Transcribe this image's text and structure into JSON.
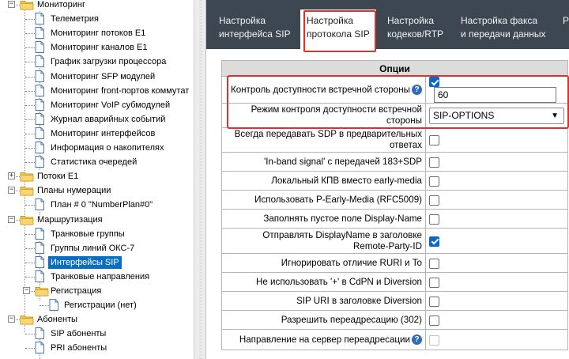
{
  "tree": {
    "items": [
      {
        "label": "Мониторинг",
        "type": "folder"
      },
      {
        "label": "Телеметрия",
        "type": "page"
      },
      {
        "label": "Мониторинг потоков E1",
        "type": "page"
      },
      {
        "label": "Мониторинг каналов E1",
        "type": "page"
      },
      {
        "label": "График загрузки процессора",
        "type": "page"
      },
      {
        "label": "Мониторинг SFP модулей",
        "type": "page"
      },
      {
        "label": "Мониторинг front-портов коммутат",
        "type": "page"
      },
      {
        "label": "Мониторинг VoIP субмодулей",
        "type": "page"
      },
      {
        "label": "Журнал аварийных событий",
        "type": "page"
      },
      {
        "label": "Мониторинг интерфейсов",
        "type": "page"
      },
      {
        "label": "Информация о накопителях",
        "type": "page"
      },
      {
        "label": "Статистика очередей",
        "type": "page"
      },
      {
        "label": "Потоки E1",
        "type": "folder",
        "expander": "+"
      },
      {
        "label": "Планы нумерации",
        "type": "folder",
        "expander": "−"
      },
      {
        "label": "План # 0 \"NumberPlan#0\"",
        "type": "page"
      },
      {
        "label": "Маршрутизация",
        "type": "folder",
        "expander": "−"
      },
      {
        "label": "Транковые группы",
        "type": "page"
      },
      {
        "label": "Группы линий ОКС-7",
        "type": "page"
      },
      {
        "label": "Интерфейсы SIP",
        "type": "page",
        "selected": true
      },
      {
        "label": "Транковые направления",
        "type": "page"
      },
      {
        "label": "Регистрация",
        "type": "folder",
        "expander": "−"
      },
      {
        "label": "Регистрации (нет)",
        "type": "page"
      },
      {
        "label": "Абоненты",
        "type": "folder",
        "expander": "−"
      },
      {
        "label": "SIP абоненты",
        "type": "page"
      },
      {
        "label": "PRI абоненты",
        "type": "page"
      }
    ]
  },
  "tabs": [
    {
      "line1": "Настройка",
      "line2": "интерфейса SIP",
      "active": false
    },
    {
      "line1": "Настройка",
      "line2": "протокола SIP",
      "active": true
    },
    {
      "line1": "Настройка",
      "line2": "кодеков/RTP",
      "active": false
    },
    {
      "line1": "Настройка факса",
      "line2": "и передачи данных",
      "active": false
    },
    {
      "line1": "Р",
      "line2": "",
      "active": false
    }
  ],
  "options": {
    "header": "Опции",
    "rows": [
      {
        "label": "Контроль доступности встречной стороны",
        "help": true,
        "control": "checkbox+number",
        "checked": true,
        "value": "60"
      },
      {
        "label": "Режим контроля доступности встречной стороны",
        "control": "select",
        "value": "SIP-OPTIONS"
      },
      {
        "label": "Всегда передавать SDP в предварительных ответах",
        "control": "checkbox",
        "checked": false
      },
      {
        "label": "'In-band signal' с передачей 183+SDP",
        "control": "checkbox",
        "checked": false
      },
      {
        "label": "Локальный КПВ вместо early-media",
        "control": "checkbox",
        "checked": false
      },
      {
        "label": "Использовать P-Early-Media (RFC5009)",
        "control": "checkbox",
        "checked": false
      },
      {
        "label": "Заполнять пустое поле Display-Name",
        "control": "checkbox",
        "checked": false
      },
      {
        "label": "Отправлять DisplayName в заголовке Remote-Party-ID",
        "control": "checkbox",
        "checked": true
      },
      {
        "label": "Игнорировать отличие RURI и To",
        "control": "checkbox",
        "checked": false
      },
      {
        "label": "Не использовать '+' в CdPN и Diversion",
        "control": "checkbox",
        "checked": false
      },
      {
        "label": "SIP URI в заголовке Diversion",
        "control": "checkbox",
        "checked": false
      },
      {
        "label": "Разрешить переадресацию (302)",
        "control": "checkbox",
        "checked": false
      },
      {
        "label": "Направление на сервер переадресации",
        "help": true,
        "control": "checkbox",
        "checked": false,
        "disabled": true
      }
    ]
  },
  "colors": {
    "tabbar_bg": "#3d4752",
    "selected_bg": "#0a6fc2",
    "checkbox_checked": "#0b66c9",
    "highlight_red": "#e0302b"
  },
  "icons": {
    "folder": "folder-icon",
    "page": "page-icon",
    "help": "help-icon",
    "select": "chevron-down-icon"
  }
}
